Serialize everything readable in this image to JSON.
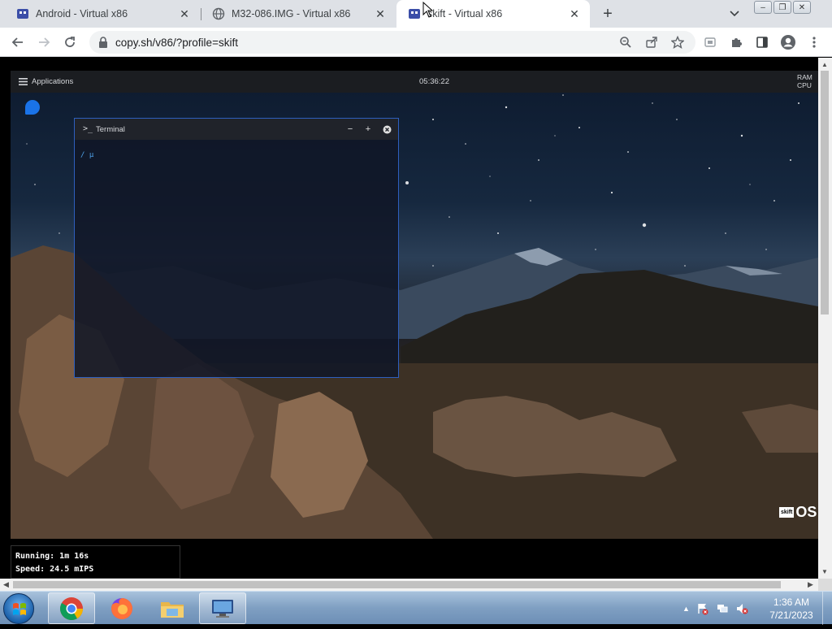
{
  "browser": {
    "tabs": [
      {
        "title": "Android - Virtual x86",
        "active": false
      },
      {
        "title": "M32-086.IMG - Virtual x86",
        "active": false
      },
      {
        "title": "skift - Virtual x86",
        "active": true
      }
    ],
    "url": "copy.sh/v86/?profile=skift"
  },
  "desktop": {
    "panel": {
      "menu_label": "Applications",
      "clock": "05:36:22",
      "ram_label": "RAM",
      "cpu_label": "CPU"
    },
    "terminal": {
      "title": "Terminal",
      "prompt": "/ µ"
    },
    "logo": {
      "box_text": "skift",
      "os_text": "OS"
    }
  },
  "status": {
    "running": "Running: 1m 16s",
    "speed": "Speed: 24.5 mIPS"
  },
  "taskbar": {
    "time": "1:36 AM",
    "date": "7/21/2023"
  },
  "colors": {
    "accent": "#1a73e8",
    "terminal_border": "#2e5fbf",
    "prompt": "#4ea1e8"
  }
}
